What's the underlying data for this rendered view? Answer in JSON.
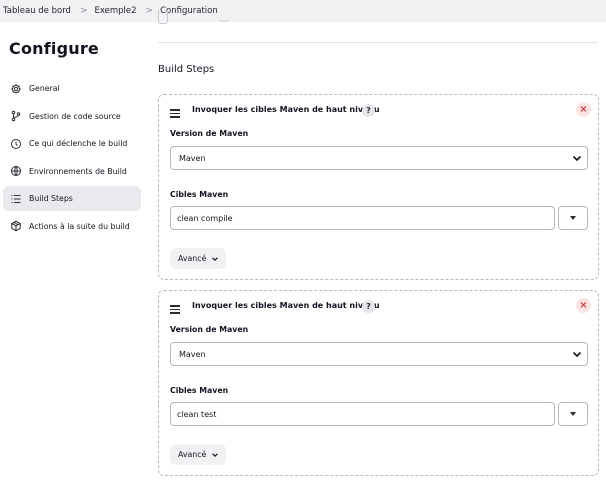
{
  "breadcrumb": {
    "items": [
      "Tableau de bord",
      "Exemple2",
      "Configuration"
    ],
    "separator": ">"
  },
  "page_title": "Configure",
  "sidebar": {
    "items": [
      {
        "label": "General",
        "icon": "gear-icon"
      },
      {
        "label": "Gestion de code source",
        "icon": "branch-icon"
      },
      {
        "label": "Ce qui déclenche le build",
        "icon": "clock-icon"
      },
      {
        "label": "Environnements de Build",
        "icon": "globe-icon"
      },
      {
        "label": "Build Steps",
        "icon": "list-icon",
        "active": true
      },
      {
        "label": "Actions à la suite du build",
        "icon": "package-icon"
      }
    ]
  },
  "section_title": "Build Steps",
  "steps": [
    {
      "title": "Invoquer les cibles Maven de haut niveau",
      "help": "?",
      "close": "×",
      "version_label": "Version de Maven",
      "version_value": "Maven",
      "goals_label": "Cibles Maven",
      "goals_value": "clean compile",
      "advanced_label": "Avancé"
    },
    {
      "title": "Invoquer les cibles Maven de haut niveau",
      "help": "?",
      "close": "×",
      "version_label": "Version de Maven",
      "version_value": "Maven",
      "goals_label": "Cibles Maven",
      "goals_value": "clean test",
      "advanced_label": "Avancé"
    }
  ],
  "colors": {
    "topbar_bg": "#f2f2f4",
    "active_item_bg": "#e9e9ee",
    "close_bg": "#fbe4e4",
    "close_fg": "#d33b3b"
  }
}
